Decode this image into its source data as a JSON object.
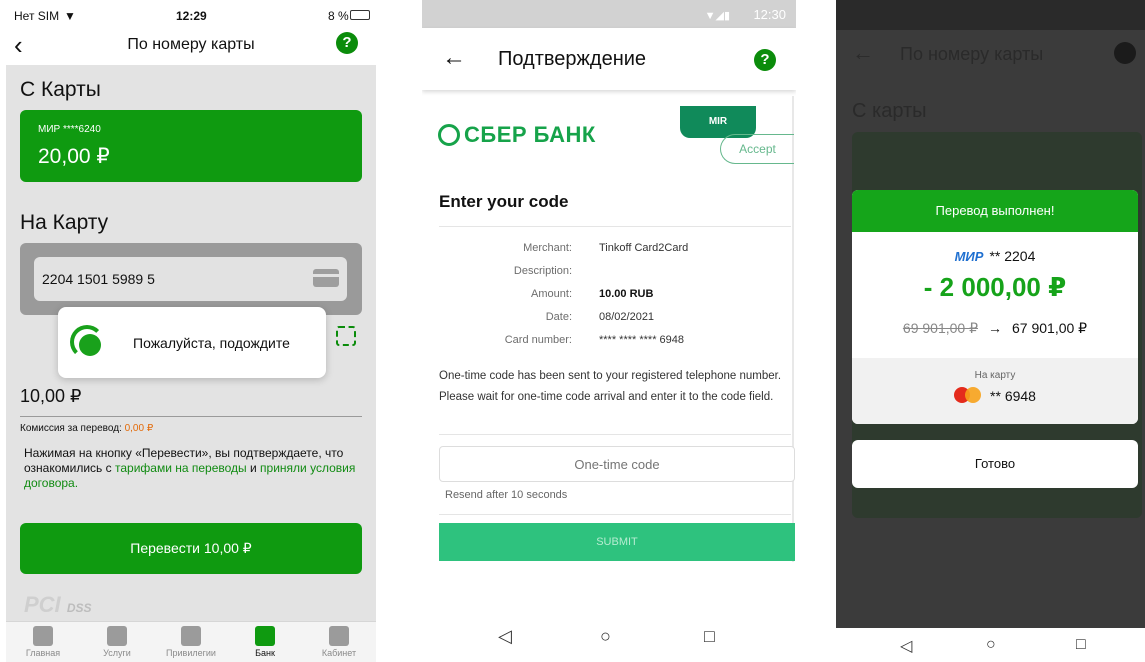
{
  "screen1": {
    "status": {
      "carrier": "Нет SIM",
      "time": "12:29",
      "battery": "8 %"
    },
    "nav": {
      "title": "По номеру карты",
      "help": "?"
    },
    "from_label": "С Карты",
    "from_card": {
      "number": "МИР ****6240",
      "balance": "20,00 ₽"
    },
    "to_label": "На Карту",
    "to_card_value": "2204 1501 5989 5",
    "toast_text": "Пожалуйста, подождите",
    "amount": "10,00 ₽",
    "fee_label": "Комиссия за перевод: ",
    "fee_value": "0,00 ₽",
    "legal": {
      "part1": "Нажимая на кнопку «Перевести», вы подтверждаете, что ознакомились с ",
      "link1": "тарифами на переводы",
      "part2": " и ",
      "link2": "приняли условия договора."
    },
    "button": "Перевести 10,00 ₽",
    "pci": "PCI",
    "pci_dss": "DSS",
    "tabs": [
      {
        "label": "Главная"
      },
      {
        "label": "Услуги"
      },
      {
        "label": "Привилегии"
      },
      {
        "label": "Банк"
      },
      {
        "label": "Кабинет"
      }
    ]
  },
  "screen2": {
    "status_time": "12:30",
    "title": "Подтверждение",
    "help": "?",
    "bank_name": "СБЕР БАНК",
    "mir_badge": "MIR",
    "accept": "Accept",
    "heading": "Enter your code",
    "details": [
      {
        "key": "Merchant:",
        "value": "Tinkoff Card2Card"
      },
      {
        "key": "Description:",
        "value": ""
      },
      {
        "key": "Amount:",
        "value": "10.00 RUB"
      },
      {
        "key": "Date:",
        "value": "08/02/2021"
      },
      {
        "key": "Card number:",
        "value": "**** **** **** 6948"
      }
    ],
    "note": "One-time code has been sent to your registered telephone number. Please wait for one-time code arrival and enter it to the code field.",
    "otp_placeholder": "One-time code",
    "resend": "Resend after 10 seconds",
    "submit": "SUBMIT"
  },
  "screen3": {
    "bg_title": "По номеру карты",
    "bg_from": "С карты",
    "header": "Перевод выполнен!",
    "mir": "МИР",
    "from_card": "** 2204",
    "sum": "- 2 000,00 ₽",
    "old_balance": "69 901,00 ₽",
    "new_balance": "67 901,00 ₽",
    "to_label": "На карту",
    "to_card": "** 6948",
    "done": "Готово"
  }
}
